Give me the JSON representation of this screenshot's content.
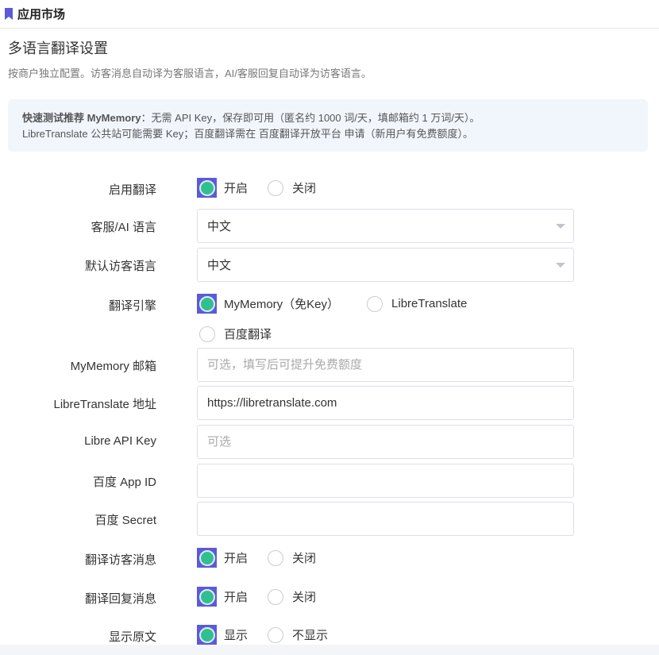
{
  "header": {
    "title": "应用市场"
  },
  "page": {
    "title": "多语言翻译设置",
    "description": "按商户独立配置。访客消息自动译为客服语言，AI/客服回复自动译为访客语言。"
  },
  "notice": {
    "line1_bold": "快速测试推荐 MyMemory",
    "line1_rest": "：无需 API Key，保存即可用（匿名约 1000 词/天，填邮箱约 1 万词/天）。",
    "line2": "LibreTranslate 公共站可能需要 Key；百度翻译需在 百度翻译开放平台 申请（新用户有免费额度）。"
  },
  "form": {
    "enable": {
      "label": "启用翻译",
      "options": [
        "开启",
        "关闭"
      ],
      "selected": "开启"
    },
    "agent_lang": {
      "label": "客服/AI 语言",
      "value": "中文"
    },
    "visitor_lang": {
      "label": "默认访客语言",
      "value": "中文"
    },
    "engine": {
      "label": "翻译引擎",
      "options": [
        "MyMemory（免Key）",
        "LibreTranslate",
        "百度翻译"
      ],
      "selected": "MyMemory（免Key）"
    },
    "mymemory_email": {
      "label": "MyMemory 邮箱",
      "value": "",
      "placeholder": "可选，填写后可提升免费额度"
    },
    "libre_url": {
      "label": "LibreTranslate 地址",
      "value": "https://libretranslate.com",
      "placeholder": ""
    },
    "libre_key": {
      "label": "Libre API Key",
      "value": "",
      "placeholder": "可选"
    },
    "baidu_appid": {
      "label": "百度 App ID",
      "value": "",
      "placeholder": ""
    },
    "baidu_secret": {
      "label": "百度 Secret",
      "value": "",
      "placeholder": ""
    },
    "translate_visitor": {
      "label": "翻译访客消息",
      "options": [
        "开启",
        "关闭"
      ],
      "selected": "开启"
    },
    "translate_reply": {
      "label": "翻译回复消息",
      "options": [
        "开启",
        "关闭"
      ],
      "selected": "开启"
    },
    "show_original": {
      "label": "显示原文",
      "options": [
        "显示",
        "不显示"
      ],
      "selected": "显示"
    }
  },
  "colors": {
    "accent": "#5b5bd6",
    "checked_dot": "#2fc08e",
    "notice_bg": "#f1f6fd"
  }
}
